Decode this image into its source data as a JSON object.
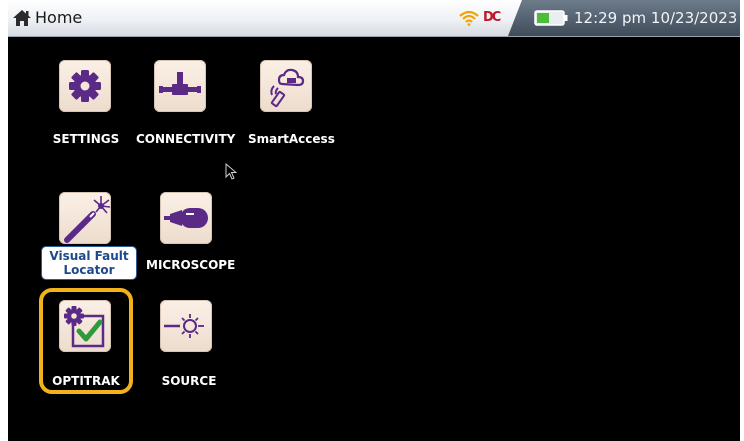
{
  "statusbar": {
    "title": "Home",
    "connection_badge": "DC",
    "clock": "12:29 pm 10/23/2023",
    "icons": [
      "home-icon",
      "wifi-icon",
      "dc-power-icon",
      "battery-icon"
    ]
  },
  "apps": {
    "settings": {
      "label": "SETTINGS",
      "icon": "gear-icon"
    },
    "connectivity": {
      "label": "CONNECTIVITY",
      "icon": "network-connector-icon"
    },
    "smartaccess": {
      "label": "SmartAccess",
      "icon": "cloud-remote-icon"
    },
    "vfl": {
      "label_line1": "Visual Fault",
      "label_line2": "Locator",
      "icon": "laser-pen-icon"
    },
    "microscope": {
      "label": "MICROSCOPE",
      "icon": "fiber-probe-icon"
    },
    "optitrak": {
      "label": "OPTITRAK",
      "icon": "gear-checkbox-icon",
      "highlighted": true
    },
    "source": {
      "label": "SOURCE",
      "icon": "light-source-icon"
    }
  },
  "colors": {
    "background": "#000000",
    "icon_purple": "#5b2a86",
    "highlight": "#f3b21a",
    "check_green": "#2e9a3a",
    "tile": "#f6e8da"
  }
}
